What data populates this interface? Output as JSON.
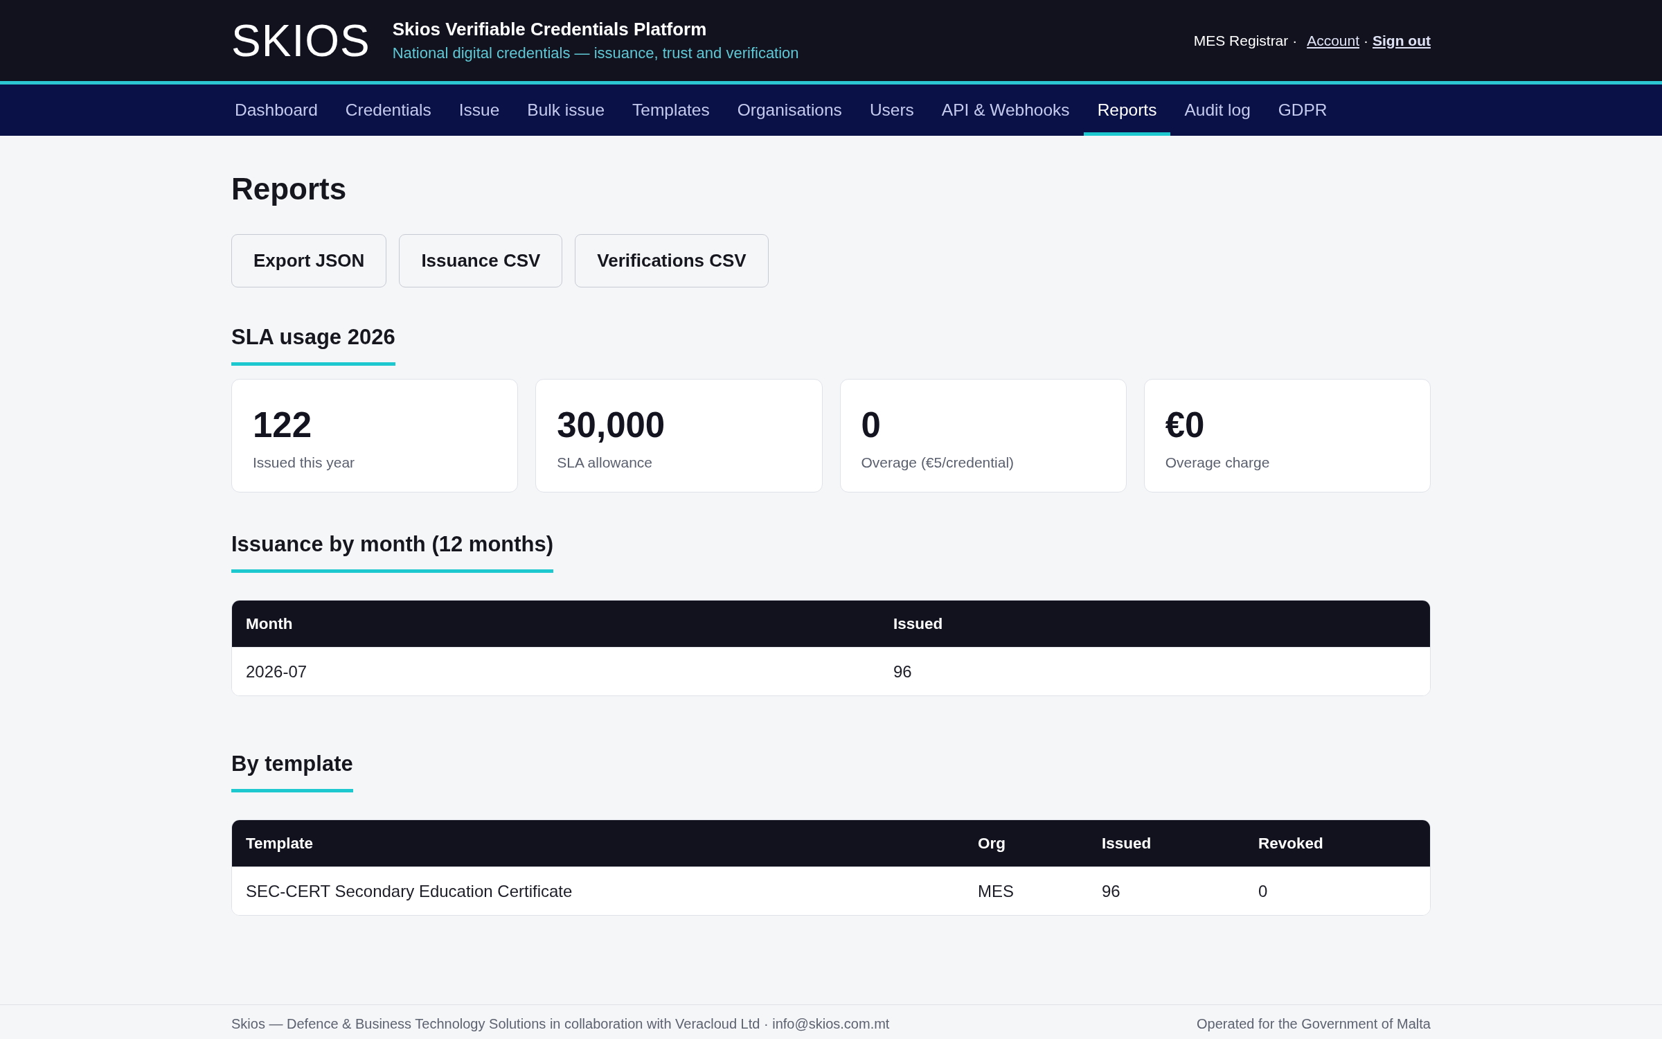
{
  "header": {
    "logo": "SKIOS",
    "title": "Skios Verifiable Credentials Platform",
    "subtitle": "National digital credentials — issuance, trust and verification",
    "account": [
      {
        "kind": "text",
        "label": "MES Registrar ·"
      },
      {
        "kind": "link",
        "label": "Account"
      },
      {
        "kind": "separator",
        "label": "·"
      },
      {
        "kind": "strong",
        "label": "Sign out"
      }
    ]
  },
  "nav": {
    "items": [
      {
        "label": "Dashboard",
        "selected": false
      },
      {
        "label": "Credentials",
        "selected": false
      },
      {
        "label": "Issue",
        "selected": false
      },
      {
        "label": "Bulk issue",
        "selected": false
      },
      {
        "label": "Templates",
        "selected": false
      },
      {
        "label": "Organisations",
        "selected": false
      },
      {
        "label": "Users",
        "selected": false
      },
      {
        "label": "API & Webhooks",
        "selected": false
      },
      {
        "label": "Reports",
        "selected": true
      },
      {
        "label": "Audit log",
        "selected": false
      },
      {
        "label": "GDPR",
        "selected": false
      }
    ]
  },
  "page": {
    "title": "Reports"
  },
  "actions": [
    "Export JSON",
    "Issuance CSV",
    "Verifications CSV"
  ],
  "sla_usage": {
    "heading": "SLA usage 2026",
    "stats": [
      {
        "value": "122",
        "label": "Issued this year"
      },
      {
        "value": "30,000",
        "label": "SLA allowance"
      },
      {
        "value": "0",
        "label": "Overage (€5/credential)"
      },
      {
        "value": "€0",
        "label": "Overage charge"
      }
    ]
  },
  "issuance_by_month": {
    "heading": "Issuance by month (12 months)",
    "table": {
      "columns": [
        "Month",
        "Issued"
      ],
      "rows": [
        [
          "2026-07",
          "96"
        ]
      ]
    }
  },
  "by_template": {
    "heading": "By template",
    "table": {
      "columns": [
        "Template",
        "Org",
        "Issued",
        "Revoked"
      ],
      "rows": [
        [
          "SEC-CERT Secondary Education Certificate",
          "MES",
          "96",
          "0"
        ]
      ]
    }
  },
  "footer": {
    "left": "Skios — Defence & Business Technology Solutions in collaboration with Veracloud Ltd · info@skios.com.mt",
    "right": "Operated for the Government of Malta"
  }
}
